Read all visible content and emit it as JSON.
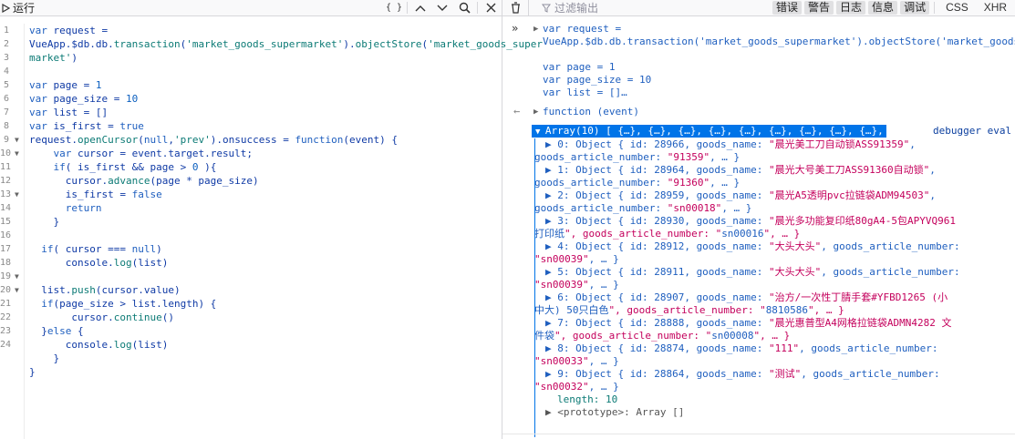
{
  "left_toolbar": {
    "run_label": "运行",
    "pretty_label": "{ }"
  },
  "editor": {
    "line_numbers": [
      "1",
      "2",
      "3",
      "4",
      "5",
      "6",
      "7",
      "8",
      "9",
      "10",
      "11",
      "12",
      "13",
      "14",
      "15",
      "16",
      "17",
      "18",
      "19",
      "20",
      "21",
      "22",
      "23",
      "24"
    ]
  },
  "right_toolbar": {
    "filter_placeholder": "过滤输出",
    "filters": [
      {
        "label": "错误",
        "active": true
      },
      {
        "label": "警告",
        "active": true
      },
      {
        "label": "日志",
        "active": true
      },
      {
        "label": "信息",
        "active": true
      },
      {
        "label": "调试",
        "active": true
      }
    ],
    "extra_filters": [
      "CSS",
      "XHR"
    ]
  },
  "console": {
    "input_lines": [
      "var request =",
      "VueApp.$db.db.transaction('market_goods_supermarket').objectStore('market_goods_superma",
      "",
      "var page = 1",
      "var page_size = 10",
      "var list = []…"
    ],
    "result_function": "function (event)",
    "array_summary": "Array(10) [ {…}, {…}, {…}, {…}, {…}, {…}, {…}, {…}, {…}, {…} ]",
    "debugger_link": "debugger eval c",
    "entries": [
      {
        "l1": "▶ 0: Object { id: 28966, goods_name: \"晨光美工刀自动锁ASS91359\",",
        "l2": "goods_article_number: \"91359\", … }"
      },
      {
        "l1": "▶ 1: Object { id: 28964, goods_name: \"晨光大号美工刀ASS91360自动锁\",",
        "l2": "goods_article_number: \"91360\", … }"
      },
      {
        "l1": "▶ 2: Object { id: 28959, goods_name: \"晨光A5透明pvc拉链袋ADM94503\",",
        "l2": "goods_article_number: \"sn00018\", … }"
      },
      {
        "l1": "▶ 3: Object { id: 28930, goods_name: \"晨光多功能复印纸80gA4-5包APYVQ961",
        "l2": "打印纸\", goods_article_number: \"sn00016\", … }"
      },
      {
        "l1": "▶ 4: Object { id: 28912, goods_name: \"大头大头\", goods_article_number:",
        "l2": "\"sn00039\", … }"
      },
      {
        "l1": "▶ 5: Object { id: 28911, goods_name: \"大头大头\", goods_article_number:",
        "l2": "\"sn00039\", … }"
      },
      {
        "l1": "▶ 6: Object { id: 28907, goods_name: \"治方/一次性丁腈手套#YFBD1265 (小",
        "l2": "中大) 50只白色\", goods_article_number: \"8810586\", … }"
      },
      {
        "l1": "▶ 7: Object { id: 28888, goods_name: \"晨光惠普型A4网格拉链袋ADMN4282 文",
        "l2": "件袋\", goods_article_number: \"sn00008\", … }"
      },
      {
        "l1": "▶ 8: Object { id: 28874, goods_name: \"111\", goods_article_number:",
        "l2": "\"sn00033\", … }"
      },
      {
        "l1": "▶ 9: Object { id: 28864, goods_name: \"测试\", goods_article_number:",
        "l2": "\"sn00032\", … }"
      }
    ],
    "length_line": "length: 10",
    "prototype_line": "▶ <prototype>: Array []"
  }
}
